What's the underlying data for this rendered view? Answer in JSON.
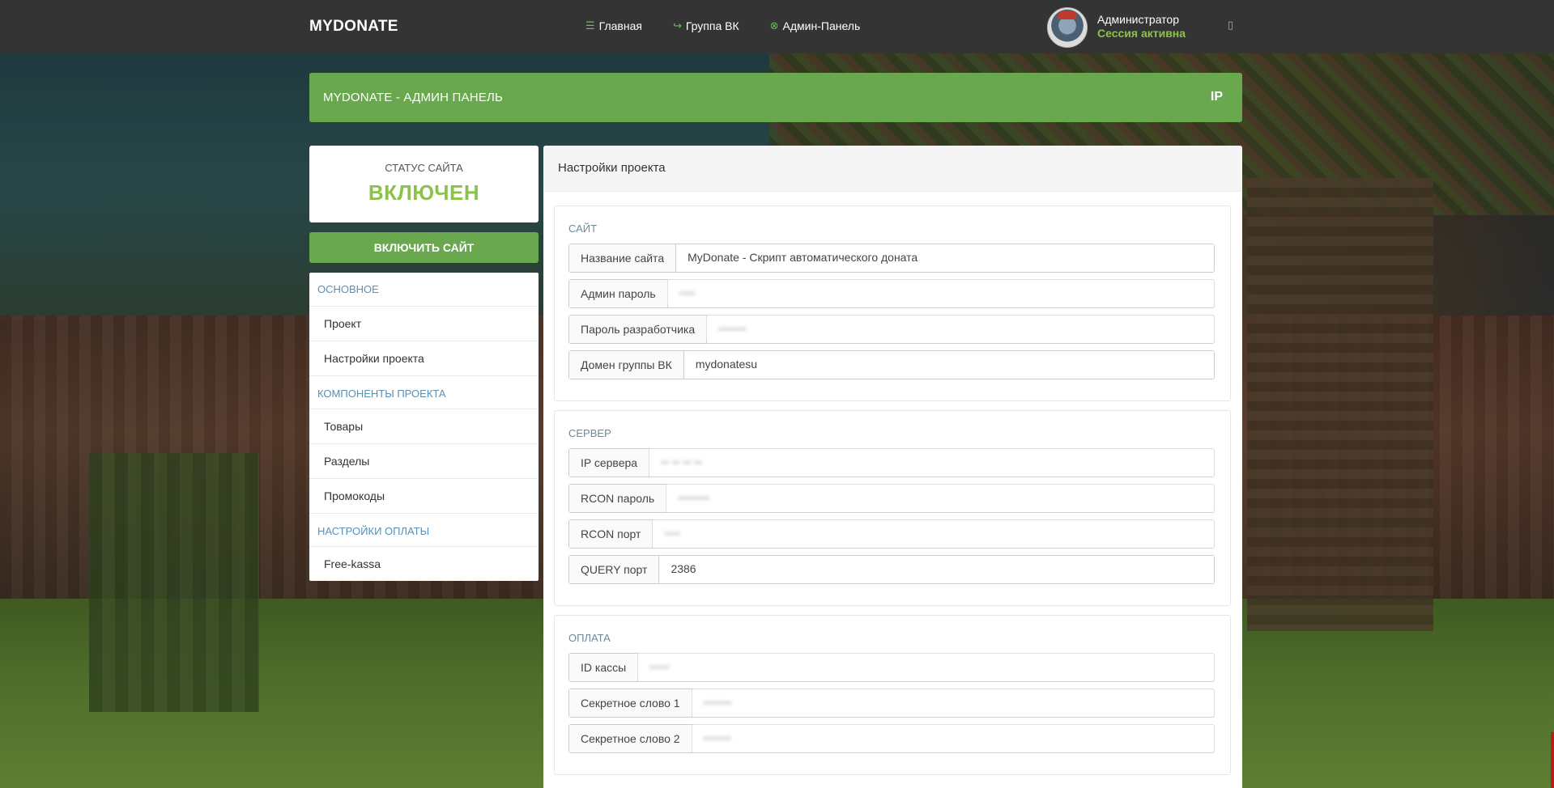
{
  "nav": {
    "brand": "MYDONATE",
    "items": [
      {
        "label": "Главная",
        "icon": "menu-icon",
        "glyph": "☰"
      },
      {
        "label": "Группа ВК",
        "icon": "share-icon",
        "glyph": "↪"
      },
      {
        "label": "Админ-Панель",
        "icon": "close-circle-icon",
        "glyph": "⊗"
      }
    ],
    "user": {
      "name": "Администратор",
      "status": "Сессия активна",
      "menu_glyph": "▯"
    }
  },
  "banner": {
    "title": "MYDONATE - АДМИН ПАНЕЛЬ",
    "ip_label": "IP"
  },
  "status": {
    "label": "СТАТУС САЙТА",
    "value": "ВКЛЮЧЕН"
  },
  "enable_button": "ВКЛЮЧИТЬ САЙТ",
  "menu": {
    "sections": [
      {
        "title": "ОСНОВНОЕ",
        "items": [
          "Проект",
          "Настройки проекта"
        ]
      },
      {
        "title": "КОМПОНЕНТЫ ПРОЕКТА",
        "items": [
          "Товары",
          "Разделы",
          "Промокоды"
        ]
      },
      {
        "title": "НАСТРОЙКИ ОПЛАТЫ",
        "items": [
          "Free-kassa"
        ]
      }
    ]
  },
  "panel": {
    "title": "Настройки проекта",
    "groups": [
      {
        "title": "САЙТ",
        "fields": [
          {
            "label": "Название сайта",
            "value": "MyDonate - Скрипт автоматического доната",
            "blurred": false
          },
          {
            "label": "Админ пароль",
            "value": "••••",
            "blurred": true
          },
          {
            "label": "Пароль разработчика",
            "value": "•••••••",
            "blurred": true
          },
          {
            "label": "Домен группы ВК",
            "value": "mydonatesu",
            "blurred": false
          }
        ]
      },
      {
        "title": "СЕРВЕР",
        "fields": [
          {
            "label": "IP сервера",
            "value": "•• •• •• ••",
            "blurred": true
          },
          {
            "label": "RCON пароль",
            "value": "••••••••",
            "blurred": true
          },
          {
            "label": "RCON порт",
            "value": "••••",
            "blurred": true
          },
          {
            "label": "QUERY порт",
            "value": "2386",
            "blurred": false
          }
        ]
      },
      {
        "title": "ОПЛАТА",
        "fields": [
          {
            "label": "ID кассы",
            "value": "•••••",
            "blurred": true
          },
          {
            "label": "Секретное слово 1",
            "value": "•••••••",
            "blurred": true
          },
          {
            "label": "Секретное слово 2",
            "value": "•••••••",
            "blurred": true
          }
        ]
      }
    ]
  },
  "colors": {
    "topbar": "#343434",
    "accent_green": "#6aa84f",
    "status_green": "#8bc34a",
    "section_title": "#5a8fb3"
  }
}
